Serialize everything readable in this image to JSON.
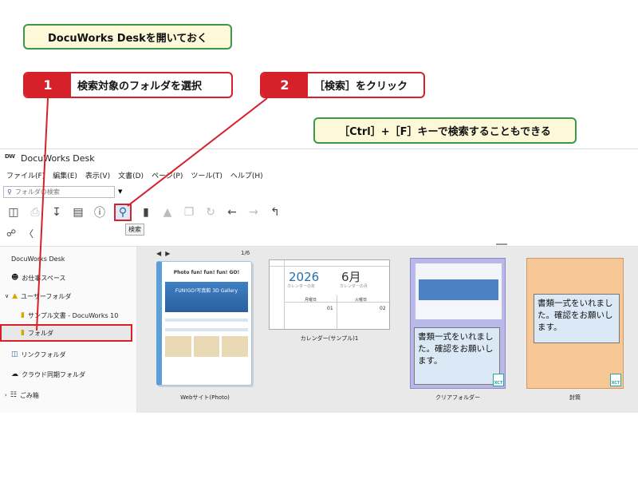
{
  "annotations": {
    "open_desk": "DocuWorks Deskを開いておく",
    "step1": {
      "num": "1",
      "text": "検索対象のフォルダを選択"
    },
    "step2": {
      "num": "2",
      "text": "［検索］をクリック"
    },
    "shortcut": "［Ctrl］+［F］キーで検索することもできる"
  },
  "window": {
    "title": "DocuWorks Desk",
    "logo": "DW"
  },
  "menu": [
    "ファイル(F)",
    "編集(E)",
    "表示(V)",
    "文書(D)",
    "ページ(P)",
    "ツール(T)",
    "ヘルプ(H)"
  ],
  "search": {
    "placeholder": "フォルダの検索"
  },
  "toolbar": {
    "icons": [
      "split-view-icon",
      "print-icon",
      "download-icon",
      "view-list-icon",
      "info-icon",
      "search-icon",
      "binder-icon",
      "stamp-icon",
      "copy-icon",
      "rotate-icon",
      "back-arrow-icon",
      "forward-arrow-icon",
      "up-folder-icon"
    ],
    "tooltip": "検索"
  },
  "sidebar": {
    "items": [
      {
        "label": "DocuWorks Desk",
        "icon": ""
      },
      {
        "label": "お仕事スペース",
        "icon": "person-icon"
      },
      {
        "label": "ユーザーフォルダ",
        "icon": "folder-icon"
      },
      {
        "label": "サンプル文書 - DocuWorks 10",
        "icon": "folder-icon"
      },
      {
        "label": "フォルダ",
        "icon": "folder-icon"
      },
      {
        "label": "リンクフォルダ",
        "icon": "link-folder-icon"
      },
      {
        "label": "クラウド同期フォルダ",
        "icon": "cloud-icon"
      },
      {
        "label": "ごみ箱",
        "icon": "trash-icon"
      }
    ]
  },
  "content": {
    "pager": "1/6",
    "docs": [
      {
        "label": "Webサイト(Photo)",
        "title": "Photo fun! fun! fun! GO!",
        "hero": "FUN!GO!写真館 3D Gallery"
      },
      {
        "label": "カレンダー(サンプル)1",
        "year": "2026",
        "month": "6月",
        "year_sub": "カレンダーの年",
        "month_sub": "カレンダーの月",
        "weekday1": "月曜日",
        "weekday2": "火曜日",
        "day1": "01",
        "day2": "02"
      },
      {
        "label": "クリアフォルダー",
        "note": "書類一式をいれました。確認をお願いします。"
      },
      {
        "label": "封筒",
        "note": "書類一式をいれました。確認をお願いします。"
      }
    ],
    "badge": "XCT"
  },
  "colors": {
    "red": "#d6202a",
    "green": "#3a9a4a",
    "callout_bg": "#fdf9d8"
  }
}
